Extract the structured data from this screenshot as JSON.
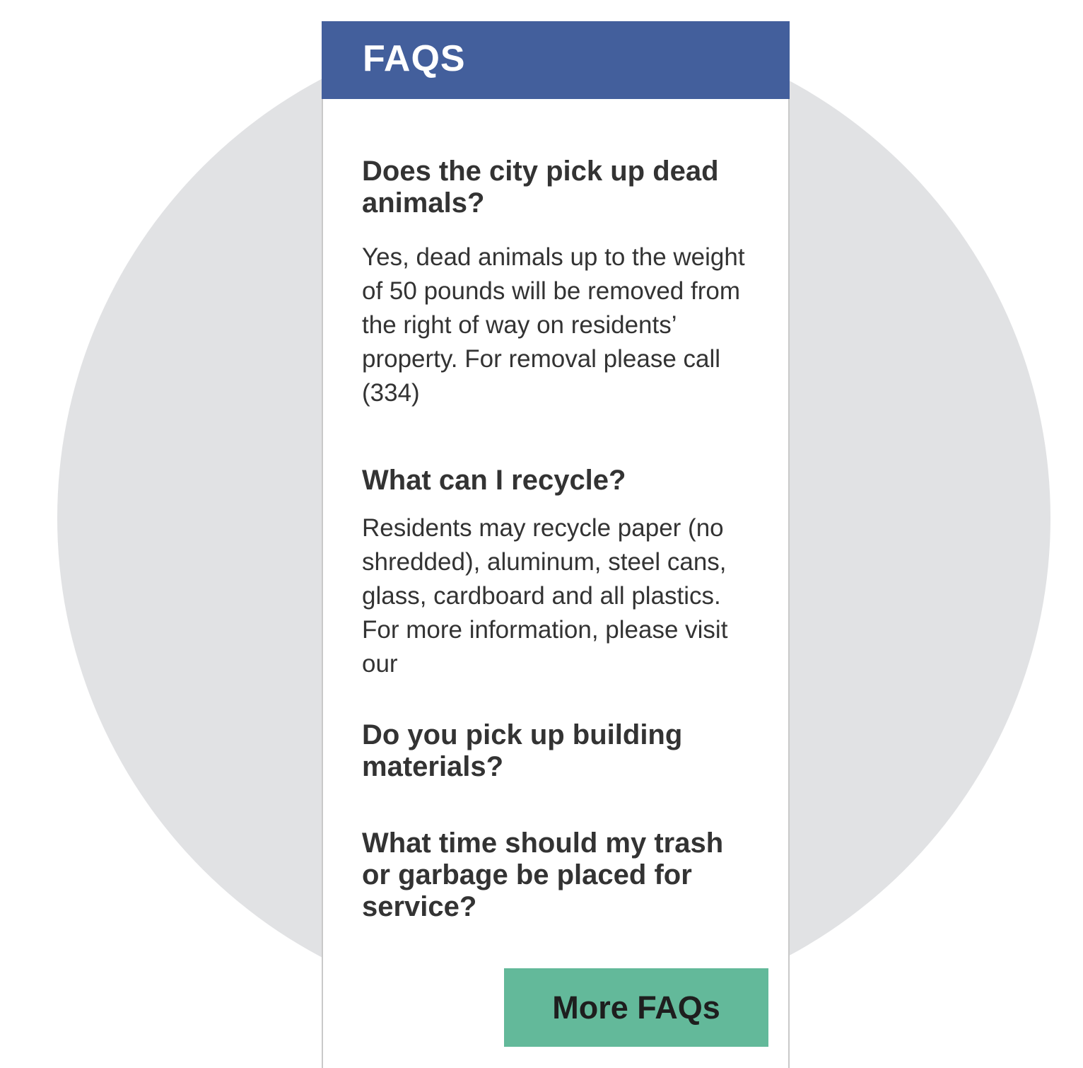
{
  "header": {
    "title": "FAQS"
  },
  "faqs": [
    {
      "question": "Does the city pick up dead animals?",
      "answer": "Yes, dead animals up to the weight of 50 pounds will be removed from the right of way on residents’ property. For removal please call (334)"
    },
    {
      "question": "What can I recycle?",
      "answer": "Residents may recycle paper (no shredded), aluminum, steel cans, glass, cardboard and all plastics. For more information, please visit our"
    },
    {
      "question": "Do you pick up building materials?"
    },
    {
      "question": "What time should my trash or garbage be placed for service?"
    }
  ],
  "actions": {
    "more_label": "More FAQs"
  },
  "colors": {
    "header_bg": "#435f9c",
    "button_bg": "#63b99a",
    "circle_bg": "#e1e2e4",
    "text": "#333333"
  }
}
